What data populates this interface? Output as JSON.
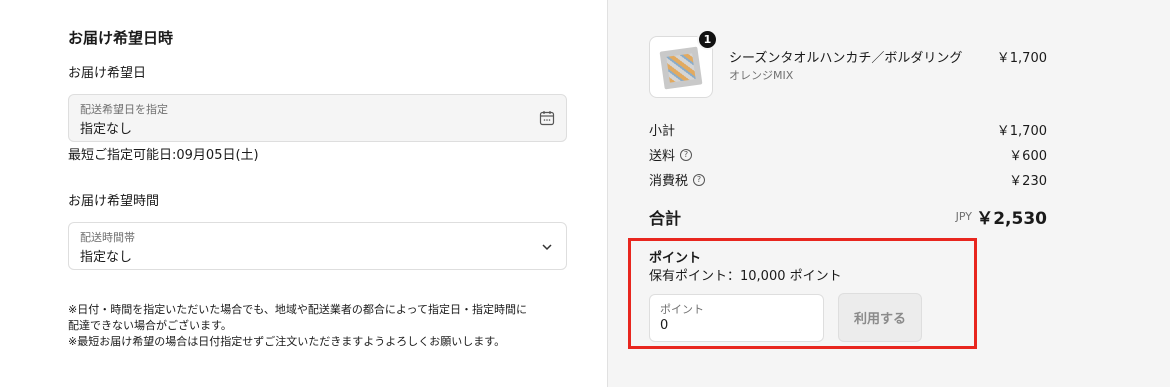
{
  "delivery": {
    "section_title": "お届け希望日時",
    "date_label": "お届け希望日",
    "date_field": {
      "label": "配送希望日を指定",
      "value": "指定なし",
      "icon": "calendar-icon"
    },
    "earliest_hint": "最短ご指定可能日:09月05日(土)",
    "time_label": "お届け希望時間",
    "time_field": {
      "label": "配送時間帯",
      "value": "指定なし",
      "icon": "chevron-down-icon"
    },
    "note_lines": [
      "※日付・時間を指定いただいた場合でも、地域や配送業者の都合によって指定日・指定時間に",
      "配達できない場合がございます。",
      "※最短お届け希望の場合は日付指定せずご注文いただきますようよろしくお願いします。"
    ]
  },
  "summary": {
    "product": {
      "quantity_badge": "1",
      "name": "シーズンタオルハンカチ／ボルダリング",
      "variant": "オレンジMIX",
      "price": "￥1,700"
    },
    "rows": [
      {
        "label": "小計",
        "value": "￥1,700",
        "help": false
      },
      {
        "label": "送料",
        "value": "￥600",
        "help": true
      },
      {
        "label": "消費税",
        "value": "￥230",
        "help": true
      }
    ],
    "help_glyph": "?",
    "total": {
      "label": "合計",
      "currency": "JPY",
      "value": "￥2,530"
    }
  },
  "points": {
    "title": "ポイント",
    "owned": "保有ポイント：10,000 ポイント",
    "field_label": "ポイント",
    "field_value": "0",
    "use_button": "利用する"
  },
  "colors": {
    "highlight": "#e8261e",
    "panel_bg": "#f5f5f5"
  }
}
